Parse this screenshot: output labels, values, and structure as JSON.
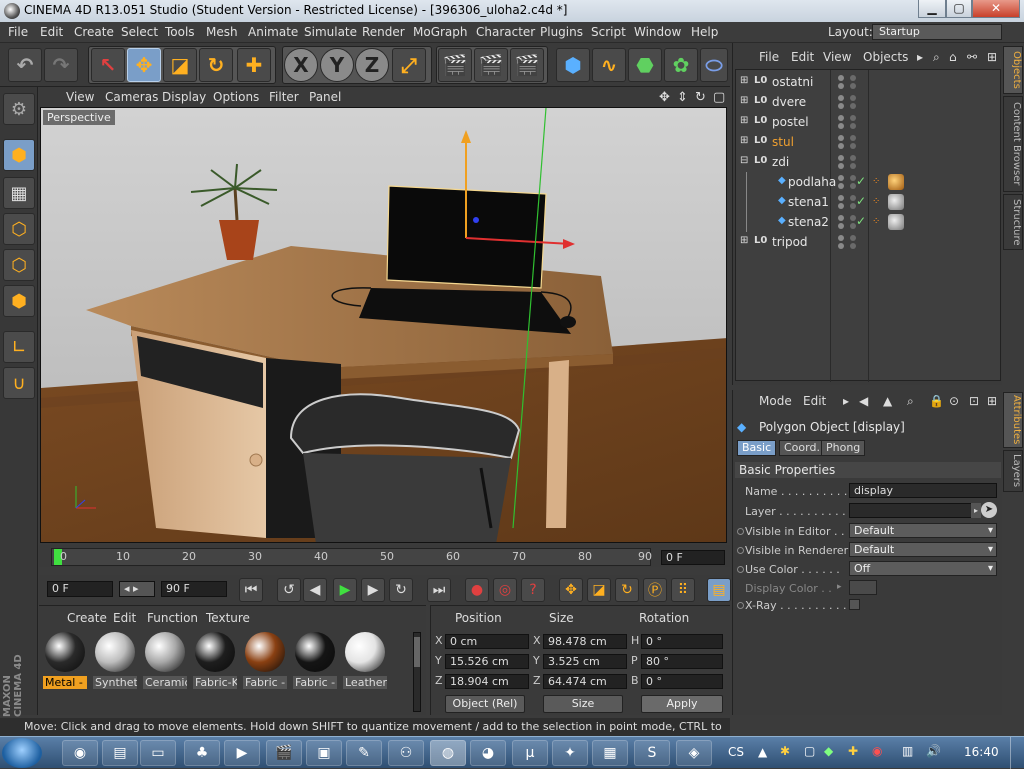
{
  "window": {
    "title": "CINEMA 4D R13.051 Studio (Student Version - Restricted License) - [396306_uloha2.c4d *]",
    "btn_min": "▁",
    "btn_max": "▢",
    "btn_close": "✕"
  },
  "menu": [
    "File",
    "Edit",
    "Create",
    "Select",
    "Tools",
    "Mesh",
    "Animate",
    "Simulate",
    "Render",
    "MoGraph",
    "Character",
    "Plugins",
    "Script",
    "Window",
    "Help"
  ],
  "layout": {
    "label": "Layout:",
    "value": "Startup"
  },
  "toolbar": {
    "undo_icon": "↶",
    "redo_icon": "↷",
    "axes": [
      "X",
      "Y",
      "Z"
    ]
  },
  "viewport": {
    "menu": [
      "View",
      "Cameras",
      "Display",
      "Options",
      "Filter",
      "Panel"
    ],
    "mode": "Perspective"
  },
  "timeline": {
    "ticks": [
      "0",
      "10",
      "20",
      "30",
      "40",
      "50",
      "60",
      "70",
      "80",
      "90"
    ],
    "current_frame": "0 F",
    "start_frame": "0 F",
    "end_frame": "90 F",
    "playhead_pos": 0
  },
  "materials": {
    "menu": [
      "Create",
      "Edit",
      "Function",
      "Texture"
    ],
    "items": [
      {
        "label": "Metal -",
        "color": "#2a2a2a",
        "selected": true
      },
      {
        "label": "Syntheti",
        "color": "#bdbdbd",
        "selected": false
      },
      {
        "label": "Ceramic",
        "color": "#a8a8a8",
        "selected": false
      },
      {
        "label": "Fabric-K",
        "color": "#1e1e1e",
        "selected": false
      },
      {
        "label": "Fabric -",
        "color": "#8a4012",
        "selected": false
      },
      {
        "label": "Fabric -",
        "color": "#151515",
        "selected": false
      },
      {
        "label": "Leather-",
        "color": "#e4e4e4",
        "selected": false
      }
    ]
  },
  "coords": {
    "headers": [
      "Position",
      "Size",
      "Rotation"
    ],
    "rows": [
      {
        "pl": "X",
        "pv": "0 cm",
        "sl": "X",
        "sv": "98.478 cm",
        "rl": "H",
        "rv": "0 °"
      },
      {
        "pl": "Y",
        "pv": "15.526 cm",
        "sl": "Y",
        "sv": "3.525 cm",
        "rl": "P",
        "rv": "80 °"
      },
      {
        "pl": "Z",
        "pv": "18.904 cm",
        "sl": "Z",
        "sv": "64.474 cm",
        "rl": "B",
        "rv": "0 °"
      }
    ],
    "mode": "Object (Rel)",
    "size_mode": "Size",
    "apply": "Apply"
  },
  "status": "Move: Click and drag to move elements. Hold down SHIFT to quantize movement / add to the selection in point mode, CTRL to remove.",
  "objects": {
    "menu": [
      "File",
      "Edit",
      "View",
      "Objects"
    ],
    "rows": [
      {
        "name": "ostatni",
        "indent": 0,
        "expanded": false,
        "type": "null",
        "highlight": false,
        "tags": false
      },
      {
        "name": "dvere",
        "indent": 0,
        "expanded": false,
        "type": "null",
        "highlight": false,
        "tags": false
      },
      {
        "name": "postel",
        "indent": 0,
        "expanded": false,
        "type": "null",
        "highlight": false,
        "tags": false
      },
      {
        "name": "stul",
        "indent": 0,
        "expanded": false,
        "type": "null",
        "highlight": true,
        "tags": false
      },
      {
        "name": "zdi",
        "indent": 0,
        "expanded": true,
        "type": "null",
        "highlight": false,
        "tags": false
      },
      {
        "name": "podlaha",
        "indent": 1,
        "expanded": false,
        "type": "poly",
        "highlight": false,
        "tags": true,
        "tagmat": "gold"
      },
      {
        "name": "stena1",
        "indent": 1,
        "expanded": false,
        "type": "poly",
        "highlight": false,
        "tags": true,
        "tagmat": "grey"
      },
      {
        "name": "stena2",
        "indent": 1,
        "expanded": false,
        "type": "poly",
        "highlight": false,
        "tags": true,
        "tagmat": "grey"
      },
      {
        "name": "tripod",
        "indent": 0,
        "expanded": false,
        "type": "null",
        "highlight": false,
        "tags": false
      }
    ]
  },
  "side_tabs_top": [
    "Objects",
    "Content Browser",
    "Structure"
  ],
  "side_tabs_bottom": [
    "Attributes",
    "Layers"
  ],
  "attributes": {
    "menu": [
      "Mode",
      "Edit"
    ],
    "title": "Polygon Object [display]",
    "tabs": [
      "Basic",
      "Coord.",
      "Phong"
    ],
    "section": "Basic Properties",
    "name_label": "Name . . . . . . . . . . .",
    "name_value": "display",
    "layer_label": "Layer . . . . . . . . . . .",
    "vis_editor_label": "Visible in Editor . .",
    "vis_editor_value": "Default",
    "vis_render_label": "Visible in Renderer",
    "vis_render_value": "Default",
    "use_color_label": "Use Color . . . . . .",
    "use_color_value": "Off",
    "display_color_label": "Display Color . .",
    "xray_label": "X-Ray . . . . . . . . . . ."
  },
  "taskbar": {
    "lang": "CS",
    "time": "16:40"
  },
  "maxon": "MAXON CINEMA 4D"
}
